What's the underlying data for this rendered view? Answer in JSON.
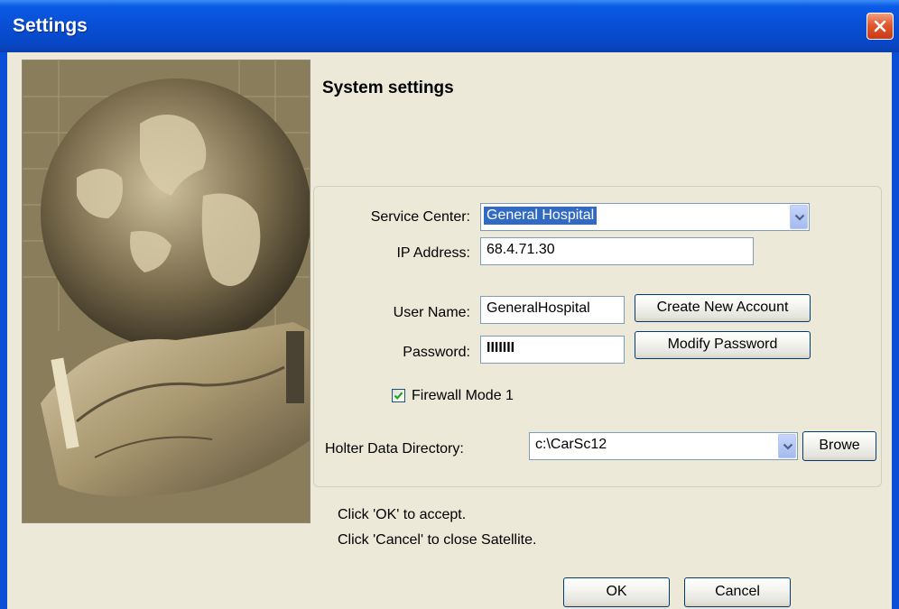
{
  "window": {
    "title": "Settings"
  },
  "heading": "System settings",
  "form": {
    "service_center_label": "Service Center:",
    "service_center_value": "General Hospital",
    "ip_address_label": "IP Address:",
    "ip_address_value": "68.4.71.30",
    "user_name_label": "User Name:",
    "user_name_value": "GeneralHospital",
    "password_label": "Password:",
    "password_value": "IIIIIII",
    "create_account_label": "Create New Account",
    "modify_password_label": "Modify Password",
    "firewall_label": "Firewall Mode 1",
    "firewall_checked": true,
    "holter_label": "Holter Data Directory:",
    "holter_value": "c:\\CarSc12",
    "browse_label": "Browe"
  },
  "info": {
    "line1": "Click 'OK' to accept.",
    "line2": "Click 'Cancel' to close Satellite."
  },
  "buttons": {
    "ok_label": "OK",
    "cancel_label": "Cancel"
  },
  "colors": {
    "titlebar": "#0a4fd6",
    "dialog_bg": "#ece9d8",
    "selection": "#316ac5",
    "close_button": "#e2572f"
  },
  "icons": {
    "close": "close-icon",
    "dropdown": "chevron-down-icon",
    "check": "checkmark-icon"
  }
}
